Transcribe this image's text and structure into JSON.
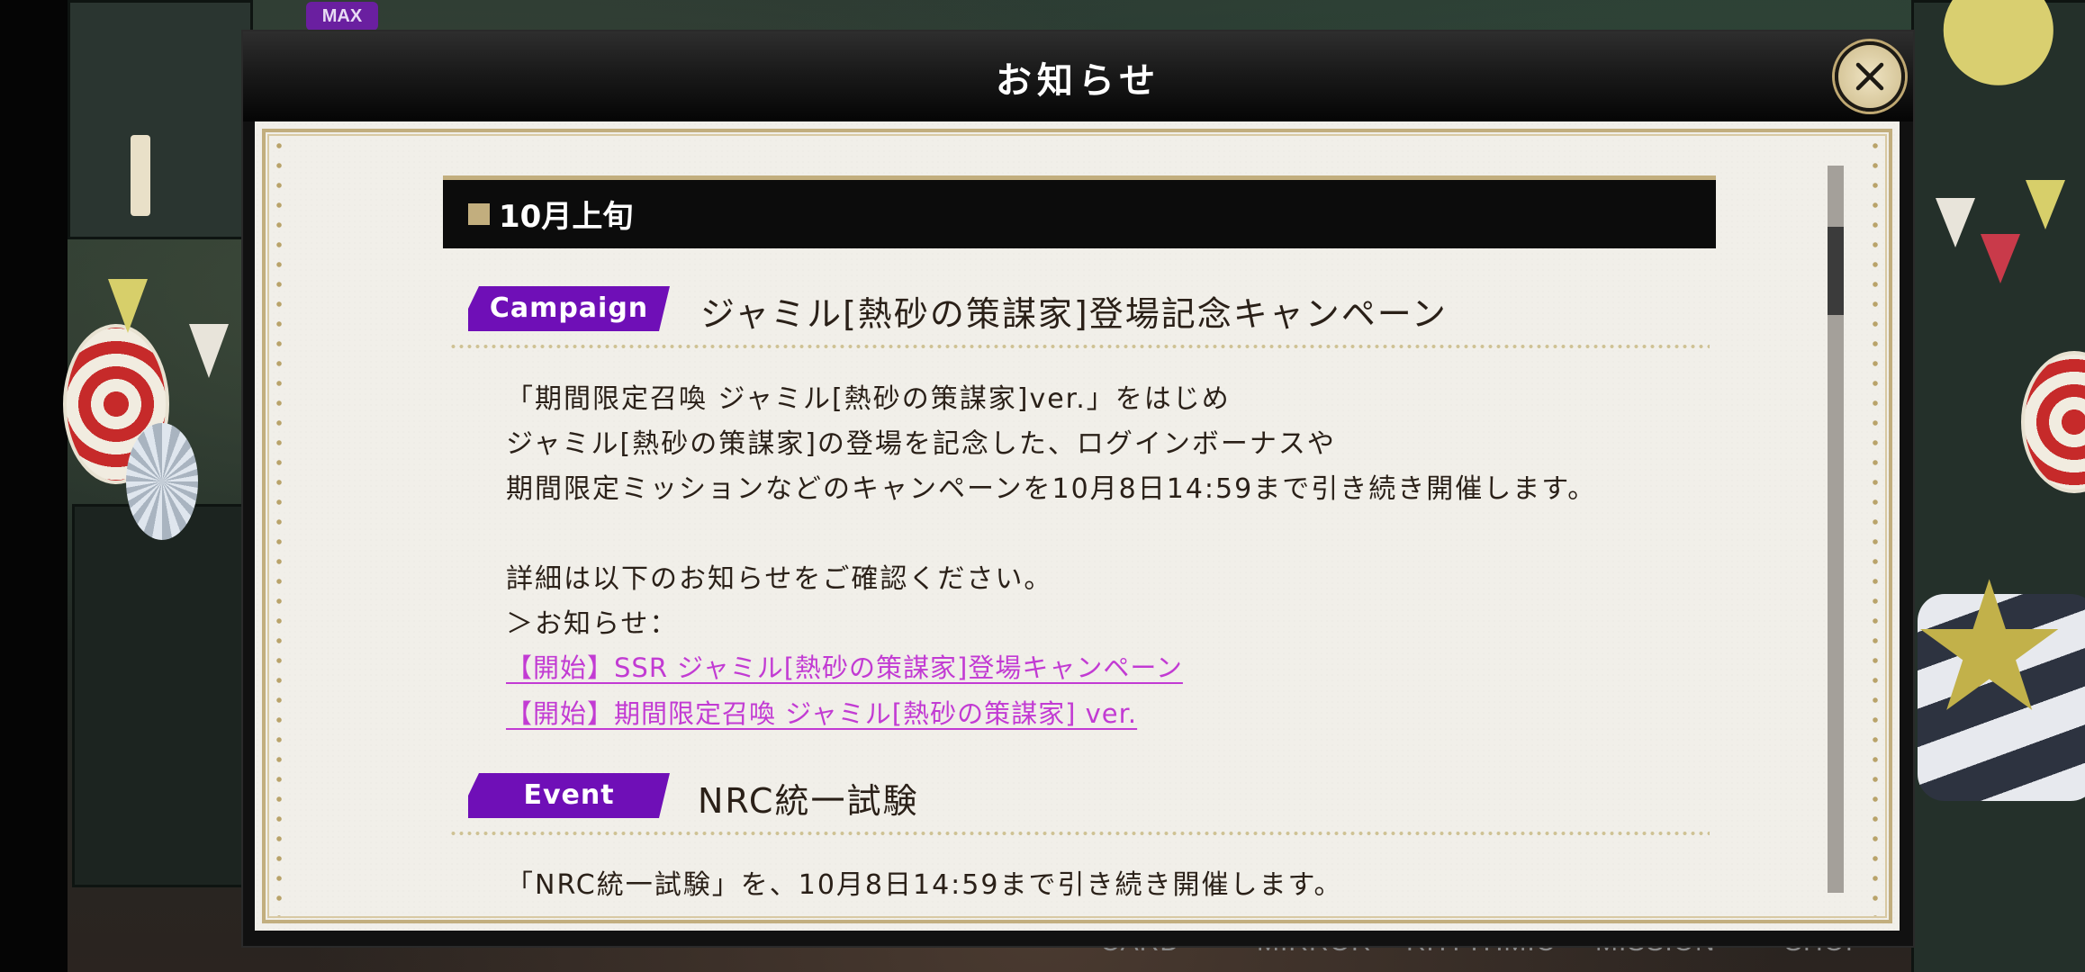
{
  "background": {
    "max_badge": "MAX",
    "nav_labels": [
      "CARD",
      "MIRROR",
      "RHYTHMIC",
      "MISSION",
      "SHOP"
    ]
  },
  "modal": {
    "title": "お知らせ",
    "close_icon": "close-icon",
    "section": {
      "label": "10月上旬"
    },
    "items": [
      {
        "tag": "Campaign",
        "tag_color": "#6f0fb7",
        "title": "ジャミル[熱砂の策謀家]登場記念キャンペーン",
        "body": [
          "「期間限定召喚 ジャミル[熱砂の策謀家]ver.」をはじめ",
          "ジャミル[熱砂の策謀家]の登場を記念した、ログインボーナスや",
          "期間限定ミッションなどのキャンペーンを10月8日14:59まで引き続き開催します。",
          "詳細は以下のお知らせをご確認ください。",
          "＞お知らせ："
        ],
        "links": [
          "【開始】SSR ジャミル[熱砂の策謀家]登場キャンペーン",
          "【開始】期間限定召喚 ジャミル[熱砂の策謀家] ver."
        ]
      },
      {
        "tag": "Event",
        "tag_color": "#6f0fb7",
        "title": "NRC統一試験",
        "body": [
          "「NRC統一試験」を、10月8日14:59まで引き続き開催します。"
        ]
      }
    ],
    "scroll_position": 0.1
  }
}
